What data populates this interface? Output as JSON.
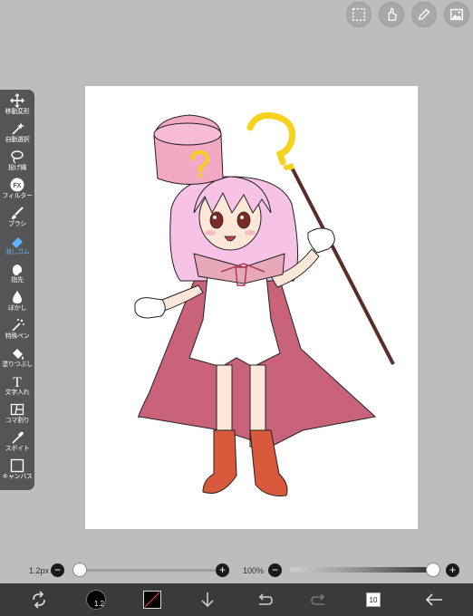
{
  "top_buttons": [
    {
      "name": "selection-icon"
    },
    {
      "name": "gesture-hand-icon"
    },
    {
      "name": "pen-edit-icon"
    },
    {
      "name": "image-gallery-icon"
    }
  ],
  "toolbar": {
    "items": [
      {
        "label": "移動変形",
        "icon": "move-arrows-icon"
      },
      {
        "label": "自動選択",
        "icon": "magic-wand-icon"
      },
      {
        "label": "投げ縄",
        "icon": "lasso-icon"
      },
      {
        "label": "フィルター",
        "icon": "fx-icon",
        "glyph": "FX"
      },
      {
        "label": "ブラシ",
        "icon": "brush-icon"
      },
      {
        "label": "消しゴム",
        "icon": "eraser-icon",
        "active": true
      },
      {
        "label": "指先",
        "icon": "finger-smudge-icon"
      },
      {
        "label": "ぼかし",
        "icon": "blur-drop-icon"
      },
      {
        "label": "特殊ペン",
        "icon": "special-pen-icon"
      },
      {
        "label": "塗りつぶし",
        "icon": "paint-bucket-icon"
      },
      {
        "label": "文字入れ",
        "icon": "text-icon",
        "glyph": "T"
      },
      {
        "label": "コマ割り",
        "icon": "frame-divider-icon"
      },
      {
        "label": "スポイト",
        "icon": "eyedropper-icon"
      },
      {
        "label": "キャンバス",
        "icon": "canvas-icon"
      }
    ],
    "accent_color": "#5fb3ff"
  },
  "sliders": {
    "brush_size_label": "1.2px",
    "brush_size_fraction": 0.0,
    "opacity_label": "100%",
    "opacity_fraction": 1.0,
    "minus": "−",
    "plus": "+"
  },
  "bottom_bar": {
    "brush_size_badge": "1.2",
    "layer_count": "10",
    "current_color": "#000000",
    "items": [
      "transform-rotate-icon",
      "brush-size-indicator",
      "color-swatch",
      "download-arrow-icon",
      "undo-icon",
      "redo-icon",
      "layers-icon",
      "back-arrow-icon"
    ]
  },
  "drawing": {
    "colors": {
      "hair": "#f6c3e6",
      "cape": "#c8637a",
      "cape_inner": "#e7a9b9",
      "hat": "#f3a9c4",
      "question": "#f6d21c",
      "boots": "#d8593c",
      "skin": "#fde7d9",
      "staff": "#5a2d2a"
    }
  }
}
